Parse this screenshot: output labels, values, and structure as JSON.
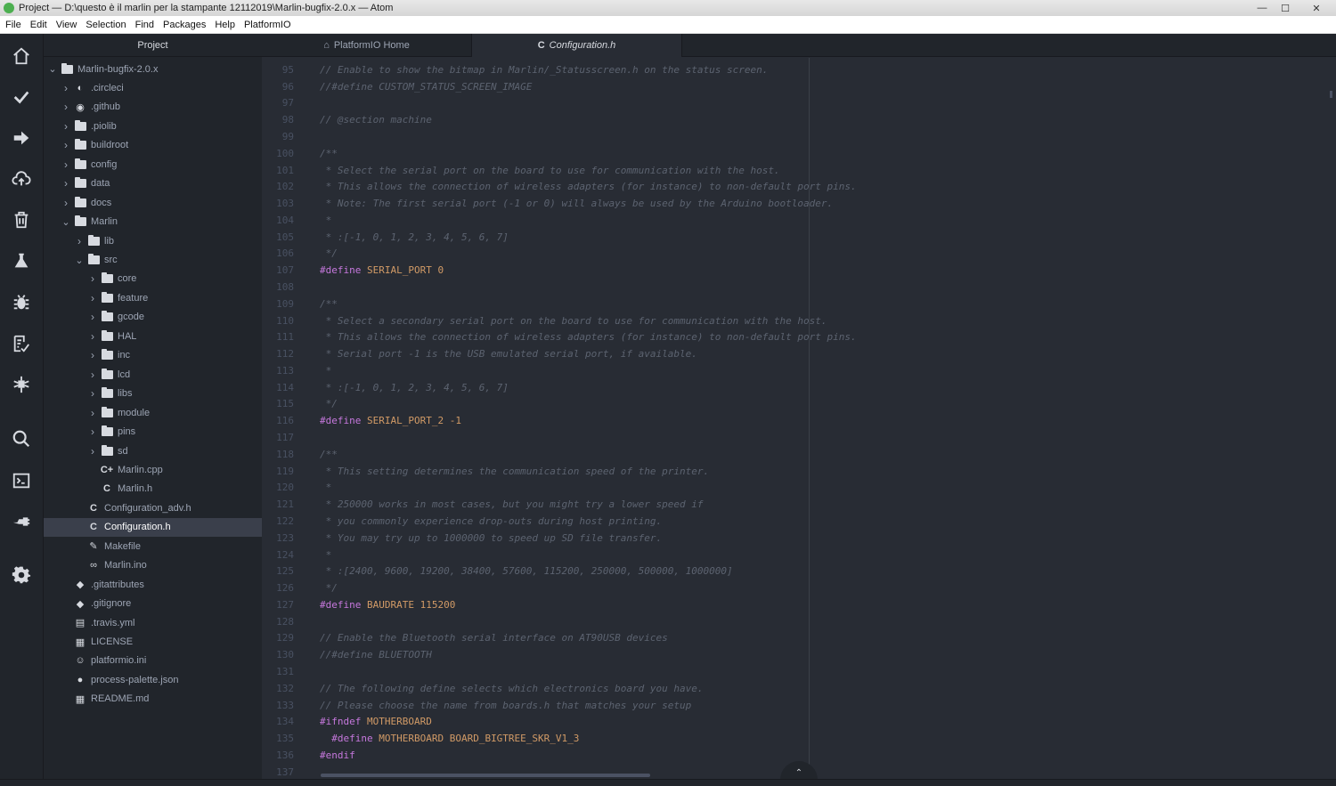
{
  "window": {
    "title": "Project — D:\\questo è il marlin per la stampante 12112019\\Marlin-bugfix-2.0.x — Atom",
    "minimize": "—",
    "maximize": "☐",
    "close": "✕"
  },
  "menu": [
    "File",
    "Edit",
    "View",
    "Selection",
    "Find",
    "Packages",
    "Help",
    "PlatformIO"
  ],
  "tree": {
    "header": "Project",
    "items": [
      {
        "label": "Marlin-bugfix-2.0.x",
        "depth": 0,
        "type": "folder",
        "open": true
      },
      {
        "label": ".circleci",
        "depth": 1,
        "type": "circleci",
        "open": false
      },
      {
        "label": ".github",
        "depth": 1,
        "type": "github",
        "open": false
      },
      {
        "label": ".piolib",
        "depth": 1,
        "type": "folder",
        "open": false
      },
      {
        "label": "buildroot",
        "depth": 1,
        "type": "folder",
        "open": false
      },
      {
        "label": "config",
        "depth": 1,
        "type": "folder",
        "open": false
      },
      {
        "label": "data",
        "depth": 1,
        "type": "folder",
        "open": false
      },
      {
        "label": "docs",
        "depth": 1,
        "type": "folder",
        "open": false
      },
      {
        "label": "Marlin",
        "depth": 1,
        "type": "folder",
        "open": true
      },
      {
        "label": "lib",
        "depth": 2,
        "type": "folder",
        "open": false
      },
      {
        "label": "src",
        "depth": 2,
        "type": "folder",
        "open": true
      },
      {
        "label": "core",
        "depth": 3,
        "type": "folder",
        "open": false
      },
      {
        "label": "feature",
        "depth": 3,
        "type": "folder",
        "open": false
      },
      {
        "label": "gcode",
        "depth": 3,
        "type": "folder",
        "open": false
      },
      {
        "label": "HAL",
        "depth": 3,
        "type": "folder",
        "open": false
      },
      {
        "label": "inc",
        "depth": 3,
        "type": "folder",
        "open": false
      },
      {
        "label": "lcd",
        "depth": 3,
        "type": "folder",
        "open": false
      },
      {
        "label": "libs",
        "depth": 3,
        "type": "folder",
        "open": false
      },
      {
        "label": "module",
        "depth": 3,
        "type": "folder",
        "open": false
      },
      {
        "label": "pins",
        "depth": 3,
        "type": "folder",
        "open": false
      },
      {
        "label": "sd",
        "depth": 3,
        "type": "folder",
        "open": false
      },
      {
        "label": "Marlin.cpp",
        "depth": 3,
        "type": "cpp"
      },
      {
        "label": "Marlin.h",
        "depth": 3,
        "type": "c"
      },
      {
        "label": "Configuration_adv.h",
        "depth": 2,
        "type": "c"
      },
      {
        "label": "Configuration.h",
        "depth": 2,
        "type": "c",
        "selected": true
      },
      {
        "label": "Makefile",
        "depth": 2,
        "type": "make"
      },
      {
        "label": "Marlin.ino",
        "depth": 2,
        "type": "ino"
      },
      {
        "label": ".gitattributes",
        "depth": 1,
        "type": "git"
      },
      {
        "label": ".gitignore",
        "depth": 1,
        "type": "git"
      },
      {
        "label": ".travis.yml",
        "depth": 1,
        "type": "yml"
      },
      {
        "label": "LICENSE",
        "depth": 1,
        "type": "book"
      },
      {
        "label": "platformio.ini",
        "depth": 1,
        "type": "pio"
      },
      {
        "label": "process-palette.json",
        "depth": 1,
        "type": "json"
      },
      {
        "label": "README.md",
        "depth": 1,
        "type": "book"
      }
    ]
  },
  "tabs": [
    {
      "label": "PlatformIO Home",
      "icon": "⌂",
      "active": false
    },
    {
      "label": "Configuration.h",
      "icon": "C",
      "active": true
    }
  ],
  "code": [
    {
      "n": "95",
      "parts": [
        [
          "cm",
          "// Enable to show the bitmap in Marlin/_Statusscreen.h on the status screen."
        ]
      ]
    },
    {
      "n": "96",
      "parts": [
        [
          "cm",
          "//#define CUSTOM_STATUS_SCREEN_IMAGE"
        ]
      ]
    },
    {
      "n": "97",
      "parts": []
    },
    {
      "n": "98",
      "parts": [
        [
          "cm",
          "// @section machine"
        ]
      ]
    },
    {
      "n": "99",
      "parts": []
    },
    {
      "n": "100",
      "parts": [
        [
          "cm",
          "/**"
        ]
      ]
    },
    {
      "n": "101",
      "parts": [
        [
          "cm",
          " * Select the serial port on the board to use for communication with the host."
        ]
      ]
    },
    {
      "n": "102",
      "parts": [
        [
          "cm",
          " * This allows the connection of wireless adapters (for instance) to non-default port pins."
        ]
      ]
    },
    {
      "n": "103",
      "parts": [
        [
          "cm",
          " * Note: The first serial port (-1 or 0) will always be used by the Arduino bootloader."
        ]
      ]
    },
    {
      "n": "104",
      "parts": [
        [
          "cm",
          " *"
        ]
      ]
    },
    {
      "n": "105",
      "parts": [
        [
          "cm",
          " * :[-1, 0, 1, 2, 3, 4, 5, 6, 7]"
        ]
      ]
    },
    {
      "n": "106",
      "parts": [
        [
          "cm",
          " */"
        ]
      ]
    },
    {
      "n": "107",
      "parts": [
        [
          "kw",
          "#define "
        ],
        [
          "df",
          "SERIAL_PORT "
        ],
        [
          "nm",
          "0"
        ]
      ]
    },
    {
      "n": "108",
      "parts": []
    },
    {
      "n": "109",
      "parts": [
        [
          "cm",
          "/**"
        ]
      ]
    },
    {
      "n": "110",
      "parts": [
        [
          "cm",
          " * Select a secondary serial port on the board to use for communication with the host."
        ]
      ]
    },
    {
      "n": "111",
      "parts": [
        [
          "cm",
          " * This allows the connection of wireless adapters (for instance) to non-default port pins."
        ]
      ]
    },
    {
      "n": "112",
      "parts": [
        [
          "cm",
          " * Serial port -1 is the USB emulated serial port, if available."
        ]
      ]
    },
    {
      "n": "113",
      "parts": [
        [
          "cm",
          " *"
        ]
      ]
    },
    {
      "n": "114",
      "parts": [
        [
          "cm",
          " * :[-1, 0, 1, 2, 3, 4, 5, 6, 7]"
        ]
      ]
    },
    {
      "n": "115",
      "parts": [
        [
          "cm",
          " */"
        ]
      ]
    },
    {
      "n": "116",
      "parts": [
        [
          "kw",
          "#define "
        ],
        [
          "df",
          "SERIAL_PORT_2 "
        ],
        [
          "nm",
          "-1"
        ]
      ]
    },
    {
      "n": "117",
      "parts": []
    },
    {
      "n": "118",
      "parts": [
        [
          "cm",
          "/**"
        ]
      ]
    },
    {
      "n": "119",
      "parts": [
        [
          "cm",
          " * This setting determines the communication speed of the printer."
        ]
      ]
    },
    {
      "n": "120",
      "parts": [
        [
          "cm",
          " *"
        ]
      ]
    },
    {
      "n": "121",
      "parts": [
        [
          "cm",
          " * 250000 works in most cases, but you might try a lower speed if"
        ]
      ]
    },
    {
      "n": "122",
      "parts": [
        [
          "cm",
          " * you commonly experience drop-outs during host printing."
        ]
      ]
    },
    {
      "n": "123",
      "parts": [
        [
          "cm",
          " * You may try up to 1000000 to speed up SD file transfer."
        ]
      ]
    },
    {
      "n": "124",
      "parts": [
        [
          "cm",
          " *"
        ]
      ]
    },
    {
      "n": "125",
      "parts": [
        [
          "cm",
          " * :[2400, 9600, 19200, 38400, 57600, 115200, 250000, 500000, 1000000]"
        ]
      ]
    },
    {
      "n": "126",
      "parts": [
        [
          "cm",
          " */"
        ]
      ]
    },
    {
      "n": "127",
      "parts": [
        [
          "kw",
          "#define "
        ],
        [
          "df",
          "BAUDRATE "
        ],
        [
          "nm",
          "115200"
        ]
      ]
    },
    {
      "n": "128",
      "parts": []
    },
    {
      "n": "129",
      "parts": [
        [
          "cm",
          "// Enable the Bluetooth serial interface on AT90USB devices"
        ]
      ]
    },
    {
      "n": "130",
      "parts": [
        [
          "cm",
          "//#define BLUETOOTH"
        ]
      ]
    },
    {
      "n": "131",
      "parts": []
    },
    {
      "n": "132",
      "parts": [
        [
          "cm",
          "// The following define selects which electronics board you have."
        ]
      ]
    },
    {
      "n": "133",
      "parts": [
        [
          "cm",
          "// Please choose the name from boards.h that matches your setup"
        ]
      ]
    },
    {
      "n": "134",
      "parts": [
        [
          "kw",
          "#ifndef "
        ],
        [
          "df",
          "MOTHERBOARD"
        ]
      ]
    },
    {
      "n": "135",
      "parts": [
        [
          "kw",
          "  #define "
        ],
        [
          "df",
          "MOTHERBOARD BOARD_BIGTREE_SKR_V1_3"
        ]
      ]
    },
    {
      "n": "136",
      "parts": [
        [
          "kw",
          "#endif"
        ]
      ]
    },
    {
      "n": "137",
      "parts": []
    }
  ],
  "dock_toggle": "⌃",
  "colors": {
    "bg": "#282c34",
    "panel": "#21252b",
    "comment": "#5c6370",
    "keyword": "#c678dd",
    "constant": "#d19a66"
  }
}
